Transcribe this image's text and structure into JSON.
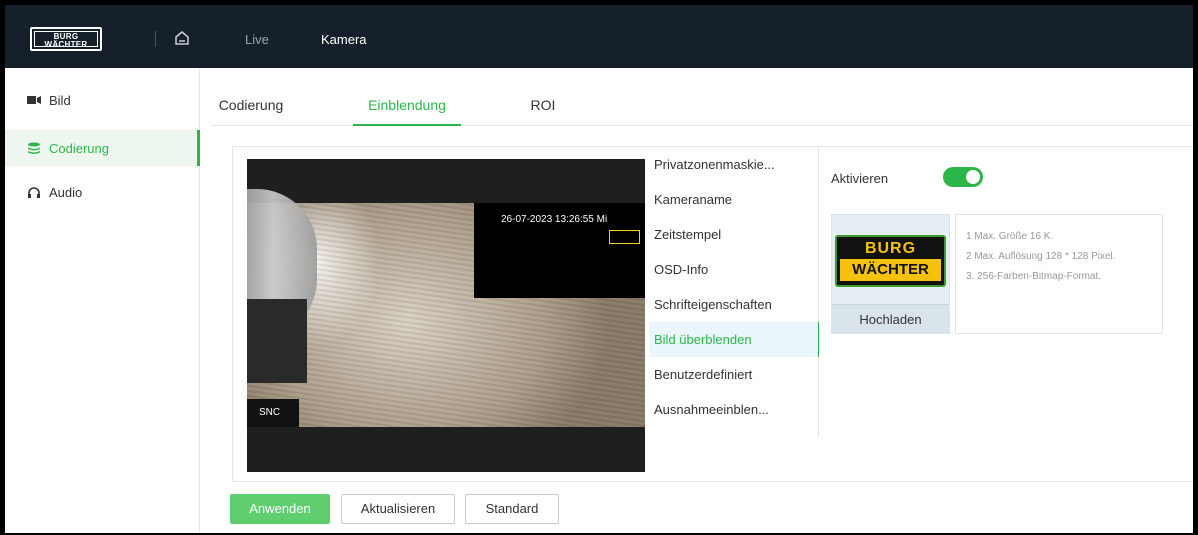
{
  "header": {
    "logo_line1": "BURG",
    "logo_line2": "WÄCHTER",
    "nav": [
      "Live",
      "Kamera"
    ],
    "active_nav": "Kamera"
  },
  "sidebar": {
    "items": [
      {
        "label": "Bild",
        "icon": "camera-icon",
        "active": false
      },
      {
        "label": "Codierung",
        "icon": "layers-icon",
        "active": true
      },
      {
        "label": "Audio",
        "icon": "headphones-icon",
        "active": false
      }
    ]
  },
  "tabs": [
    {
      "label": "Codierung",
      "active": false
    },
    {
      "label": "Einblendung",
      "active": true
    },
    {
      "label": "ROI",
      "active": false
    }
  ],
  "preview": {
    "timestamp": "26-07-2023 13:26:55 Mi",
    "corner_label": "SNC"
  },
  "submenu": {
    "items": [
      "Privatzonenmaskie...",
      "Kameraname",
      "Zeitstempel",
      "OSD-Info",
      "Schrifteigenschaften",
      "Bild überblenden",
      "Benutzerdefiniert",
      "Ausnahmeeinblen..."
    ],
    "active_index": 5
  },
  "overlay": {
    "enable_label": "Aktivieren",
    "enabled": true,
    "logo_line1": "BURG",
    "logo_line2": "WÄCHTER",
    "upload_label": "Hochladen",
    "hints": [
      "1 Max. Größe 16 K.",
      "2 Max. Auflösung 128 * 128 Pixel.",
      "3. 256-Farben-Bitmap-Format."
    ]
  },
  "actions": {
    "apply": "Anwenden",
    "refresh": "Aktualisieren",
    "default": "Standard"
  },
  "colors": {
    "accent": "#2cb64a",
    "header_bg": "#16202b",
    "apply_bg": "#5ece6f"
  }
}
